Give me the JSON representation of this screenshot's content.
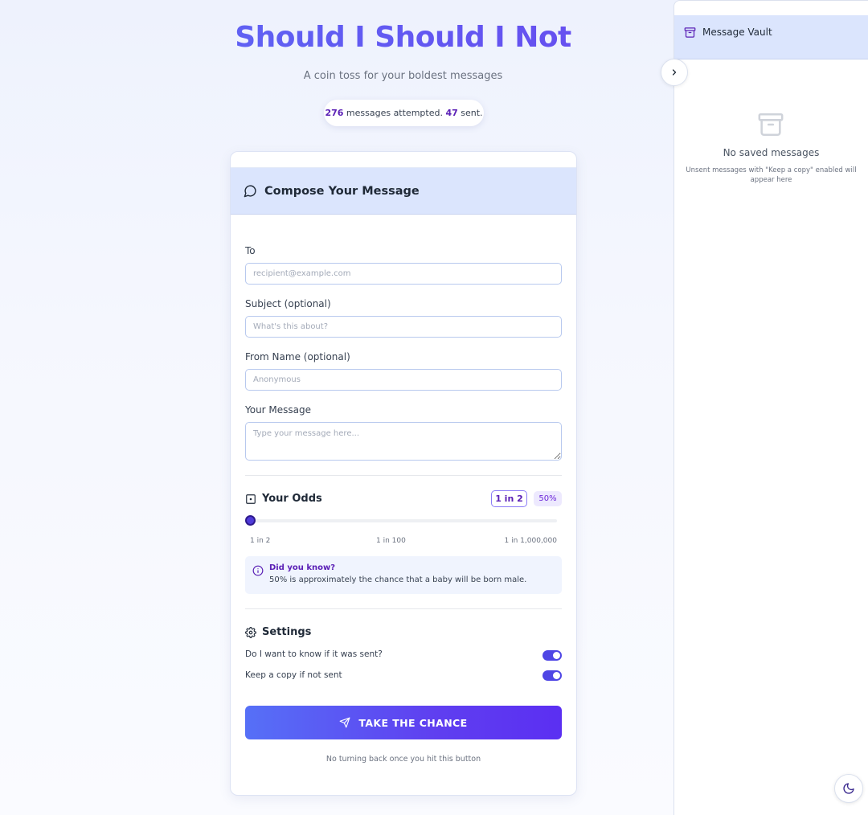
{
  "app": {
    "title": "Should I Should I Not",
    "subtitle": "A coin toss for your boldest messages"
  },
  "stats": {
    "attempted": "276",
    "attempted_suffix": " messages attempted. ",
    "sent": "47",
    "sent_suffix": " sent."
  },
  "compose": {
    "header": "Compose Your Message",
    "to_label": "To",
    "to_placeholder": "recipient@example.com",
    "subject_label": "Subject (optional)",
    "subject_placeholder": "What's this about?",
    "from_label": "From Name (optional)",
    "from_placeholder": "Anonymous",
    "message_label": "Your Message",
    "message_placeholder": "Type your message here..."
  },
  "odds": {
    "title": "Your Odds",
    "badge": "1 in 2",
    "percent": "50%",
    "slider_fraction": 0,
    "ticks": [
      "1 in 2",
      "1 in 100",
      "1 in 1,000,000"
    ],
    "info_title": "Did you know?",
    "info_text": "50% is approximately the chance that a baby will be born male."
  },
  "settings": {
    "title": "Settings",
    "items": [
      {
        "label": "Do I want to know if it was sent?",
        "on": true
      },
      {
        "label": "Keep a copy if not sent",
        "on": true
      }
    ]
  },
  "cta": {
    "label": "TAKE THE CHANCE",
    "footnote": "No turning back once you hit this button"
  },
  "vault": {
    "title": "Message Vault",
    "empty_title": "No saved messages",
    "empty_text": "Unsent messages with \"Keep a copy\" enabled will appear here"
  },
  "colors": {
    "accent": "#5b21b6",
    "primary": "#5b5ff5",
    "header_bg": "#dbe5fd"
  },
  "icons": {
    "compose": "message-circle-icon",
    "odds": "dice-icon",
    "info": "info-icon",
    "settings": "gear-icon",
    "cta": "send-icon",
    "vault": "archive-icon",
    "collapse": "chevron-right-icon",
    "theme": "moon-icon"
  }
}
